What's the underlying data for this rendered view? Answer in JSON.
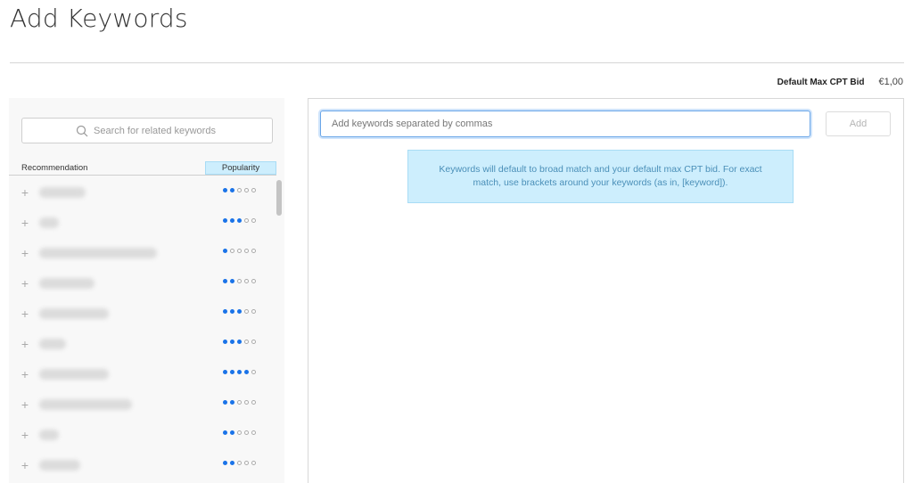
{
  "header": {
    "title": "Add Keywords"
  },
  "bid": {
    "label": "Default Max CPT Bid",
    "value": "€1,00"
  },
  "left_panel": {
    "search_placeholder": "Search for related keywords",
    "columns": {
      "recommendation": "Recommendation",
      "popularity": "Popularity"
    },
    "rows": [
      {
        "keyword": "xxxxx xxxxx",
        "popularity": 2
      },
      {
        "keyword": "xxxx",
        "popularity": 3
      },
      {
        "keyword": "xxxxxxxx xxxxxxx xxxxxx",
        "popularity": 1
      },
      {
        "keyword": "xxxxx xxxxxx",
        "popularity": 2
      },
      {
        "keyword": "xxxxxx xxxxxx",
        "popularity": 3
      },
      {
        "keyword": "xxxxx",
        "popularity": 3
      },
      {
        "keyword": "xx xxxx xxxxxx",
        "popularity": 4
      },
      {
        "keyword": "xxxx xxxx xx xxxxxxx",
        "popularity": 2
      },
      {
        "keyword": "xxxx",
        "popularity": 2
      },
      {
        "keyword": "xxxx xxxx",
        "popularity": 2
      }
    ],
    "max_popularity": 5
  },
  "right_panel": {
    "input_placeholder": "Add keywords separated by commas",
    "add_label": "Add",
    "info_text": "Keywords will default to broad match and your default max CPT bid. For exact match, use brackets around your keywords (as in, [keyword])."
  },
  "colors": {
    "accent": "#1a73e8",
    "info_bg": "#cdeefd",
    "info_text": "#4a8fb8"
  }
}
